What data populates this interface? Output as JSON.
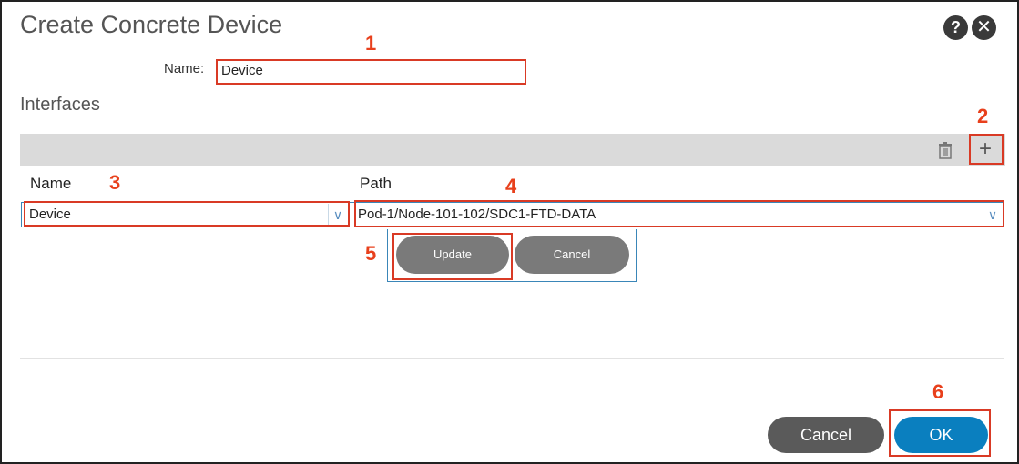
{
  "dialog": {
    "title": "Create Concrete Device",
    "help_icon": "?",
    "close_icon": "✕"
  },
  "name_field": {
    "label": "Name:",
    "value": "Device"
  },
  "interfaces": {
    "title": "Interfaces",
    "toolbar": {
      "delete_icon": "trash-icon",
      "add_icon": "+"
    },
    "columns": [
      "Name",
      "Path"
    ],
    "row": {
      "name_value": "Device",
      "path_value": "Pod-1/Node-101-102/SDC1-FTD-DATA"
    },
    "row_actions": {
      "update_label": "Update",
      "cancel_label": "Cancel"
    }
  },
  "footer": {
    "cancel_label": "Cancel",
    "ok_label": "OK"
  },
  "annotations": [
    "1",
    "2",
    "3",
    "4",
    "5",
    "6"
  ],
  "colors": {
    "highlight": "#d93a25",
    "annotation_number": "#e8401c",
    "primary_button": "#0a7fbf",
    "secondary_button": "#5a5a5a",
    "pill_button": "#7a7a7a"
  }
}
